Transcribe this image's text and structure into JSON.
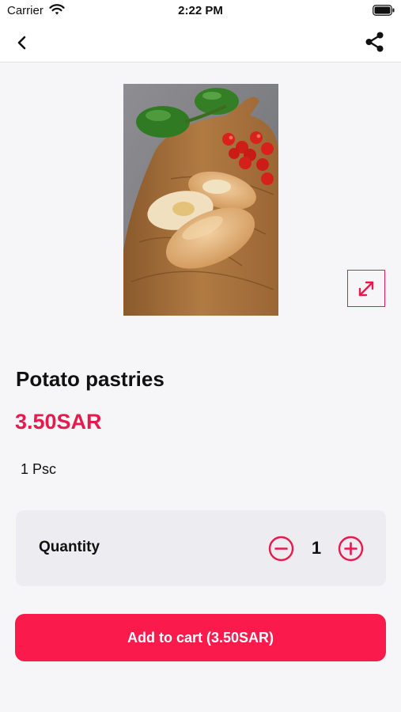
{
  "status_bar": {
    "carrier": "Carrier",
    "time": "2:22 PM"
  },
  "nav": {
    "back_icon": "chevron-left-icon",
    "share_icon": "share-icon"
  },
  "product": {
    "image_alt": "Potato pastries on wooden board with peppers and cherry tomatoes",
    "expand_icon": "expand-arrows-icon",
    "name": "Potato pastries",
    "price": "3.50SAR",
    "unit": "1 Psc"
  },
  "quantity": {
    "label": "Quantity",
    "value": "1",
    "minus_icon": "minus-circle-icon",
    "plus_icon": "plus-circle-icon"
  },
  "cart": {
    "button_label": "Add to cart (3.50SAR)"
  },
  "colors": {
    "accent": "#e8194c",
    "button": "#fa1a4c",
    "background": "#f6f6f8",
    "card": "#ededf1"
  }
}
